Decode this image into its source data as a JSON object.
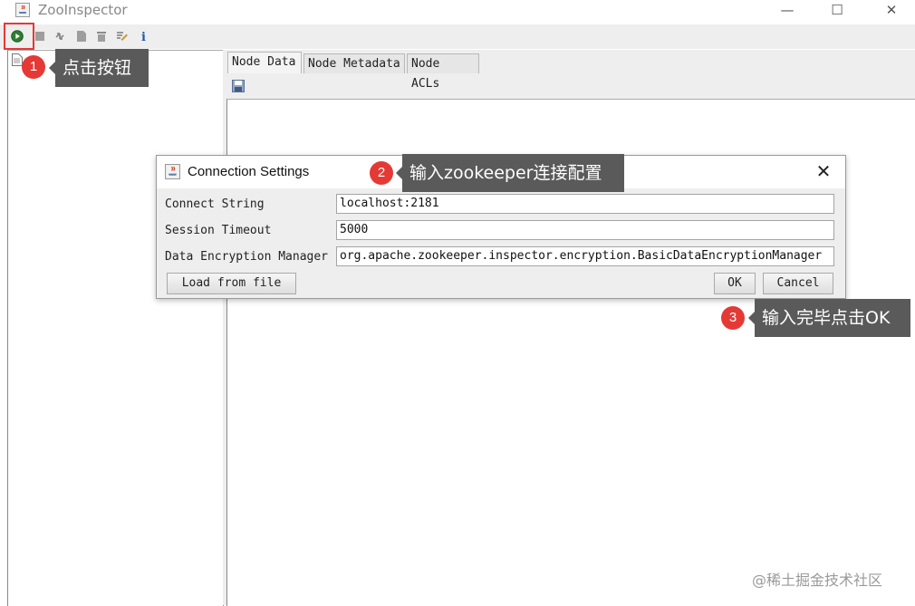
{
  "window": {
    "title": "ZooInspector"
  },
  "toolbar": {
    "buttons": [
      "connect-icon",
      "disconnect-icon",
      "refresh-icon",
      "add-node-icon",
      "delete-node-icon",
      "edit-icon",
      "info-icon"
    ]
  },
  "tabs": [
    {
      "label": "Node Data",
      "active": true
    },
    {
      "label": "Node Metadata",
      "active": false
    },
    {
      "label": "Node ACLs",
      "active": false
    }
  ],
  "dialog": {
    "title": "Connection Settings",
    "fields": [
      {
        "label": "Connect String",
        "value": "localhost:2181"
      },
      {
        "label": "Session Timeout",
        "value": "5000"
      },
      {
        "label": "Data Encryption Manager",
        "value": "org.apache.zookeeper.inspector.encryption.BasicDataEncryptionManager"
      }
    ],
    "load_button": "Load from file",
    "ok_button": "OK",
    "cancel_button": "Cancel"
  },
  "annotations": [
    {
      "number": "1",
      "text": "点击按钮"
    },
    {
      "number": "2",
      "text": "输入zookeeper连接配置"
    },
    {
      "number": "3",
      "text": "输入完毕点击OK"
    }
  ],
  "watermark": "@稀土掘金技术社区",
  "colors": {
    "badge": "#e53935",
    "callout": "#5a5a5a",
    "connect": "#2e7d32"
  }
}
